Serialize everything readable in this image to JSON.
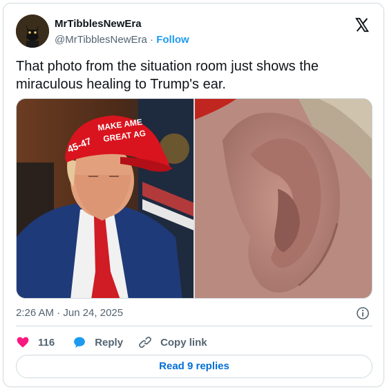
{
  "author": {
    "display_name": "MrTibblesNewEra",
    "handle": "@MrTibblesNewEra",
    "separator": "·",
    "follow_label": "Follow"
  },
  "tweet": {
    "text_line1": "That photo from the situation room just shows the",
    "text_line2": "miraculous healing to Trump's ear.",
    "timestamp": "2:26 AM · Jun 24, 2025"
  },
  "media": {
    "left_image": "man-in-red-cap-photo",
    "right_image": "ear-closeup-photo",
    "cap_text_line1": "MAKE AME",
    "cap_text_line2": "GREAT AG",
    "cap_side_text": "45-47"
  },
  "actions": {
    "like_count": "116",
    "reply_label": "Reply",
    "copy_link_label": "Copy link",
    "read_replies_label": "Read 9 replies"
  },
  "colors": {
    "brand_blue": "#1d9bf0",
    "link_blue": "#006fd6",
    "heart": "#f91880",
    "muted": "#536471",
    "border": "#cfd9de"
  },
  "icons": [
    "x-logo-icon",
    "info-icon",
    "heart-icon",
    "reply-bubble-icon",
    "link-icon"
  ]
}
